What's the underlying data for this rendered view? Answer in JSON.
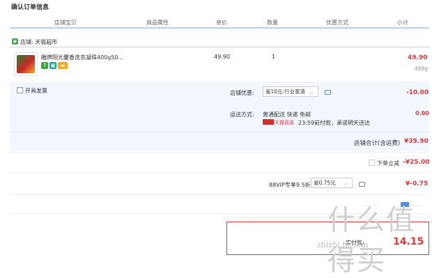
{
  "page_title": "确认订单信息",
  "columns": {
    "item": "店铺宝贝",
    "attr": "商品属性",
    "unit_price": "单价",
    "quantity": "数量",
    "discount": "优惠方式",
    "subtotal": "小计"
  },
  "shop": {
    "label": "店铺: 天猫超市"
  },
  "item": {
    "name": "雕牌阳光馨香洗衣凝珠400g50...",
    "unit_price": "49.90",
    "quantity": "1",
    "subtotal": "49.90",
    "weight": "488g"
  },
  "invoice": {
    "label": "开具发票"
  },
  "shop_discount": {
    "label": "店铺优惠:",
    "selected": "省10元:行业家清",
    "amount": "-10.00"
  },
  "shipping": {
    "label": "运送方式:",
    "method": "普通配送 快递 免邮",
    "tmall_direct": "天猫直送",
    "promise": "23:59前付款，承诺明天送达",
    "amount": "0.00"
  },
  "shop_total": {
    "label": "店铺合计(含运费)",
    "value": "¥39.90"
  },
  "instant_discount": {
    "label": "下单立减",
    "value": "-¥25.00"
  },
  "vip": {
    "label": "88VIP专享9.5折",
    "selected": "省0.75元",
    "value": "¥-0.75"
  },
  "watermark": {
    "text": "什么值得买",
    "url": "zhizhi.hi.com"
  },
  "footer": {
    "pay_label": "实付款:",
    "pay_value": "14.15"
  },
  "colors": {
    "accent_red": "#e4393c",
    "header_line": "#b2d1ff",
    "row_bg": "#f2f7ff"
  }
}
